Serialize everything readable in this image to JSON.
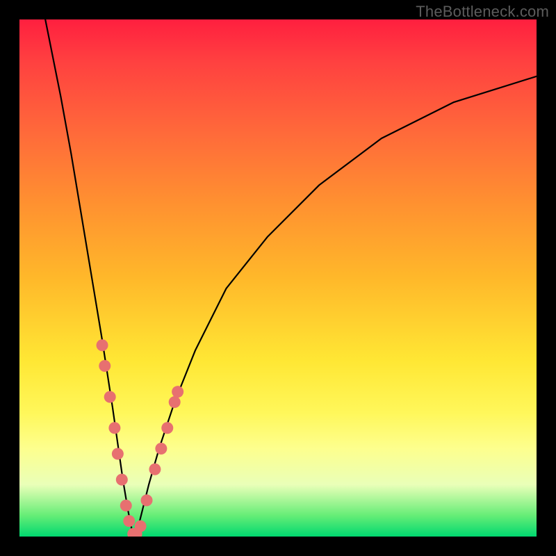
{
  "watermark": "TheBottleneck.com",
  "colors": {
    "curve_stroke": "#000000",
    "marker_fill": "#e77070",
    "marker_stroke": "#c85858",
    "gradient_top": "#ff1f3f",
    "gradient_bottom": "#00d870",
    "frame_bg": "#000000"
  },
  "chart_data": {
    "type": "line",
    "title": "",
    "xlabel": "",
    "ylabel": "",
    "xlim": [
      0,
      100
    ],
    "ylim": [
      0,
      100
    ],
    "grid": false,
    "legend": false,
    "note": "V-shaped bottleneck curve; y=0 at minimum (~x=22), rises steeply both sides. Markers cluster near the trough on both branches where y is low (green band).",
    "series": [
      {
        "name": "bottleneck-curve",
        "x": [
          5,
          8,
          10,
          12,
          14,
          16,
          18,
          19,
          20,
          21,
          22,
          23,
          24,
          25,
          27,
          30,
          34,
          40,
          48,
          58,
          70,
          84,
          100
        ],
        "y": [
          100,
          85,
          74,
          62,
          50,
          38,
          25,
          18,
          11,
          5,
          0,
          2,
          6,
          10,
          17,
          26,
          36,
          48,
          58,
          68,
          77,
          84,
          89
        ]
      }
    ],
    "markers": [
      {
        "x": 16.0,
        "y": 37
      },
      {
        "x": 16.5,
        "y": 33
      },
      {
        "x": 17.5,
        "y": 27
      },
      {
        "x": 18.4,
        "y": 21
      },
      {
        "x": 19.0,
        "y": 16
      },
      {
        "x": 19.8,
        "y": 11
      },
      {
        "x": 20.6,
        "y": 6
      },
      {
        "x": 21.2,
        "y": 3
      },
      {
        "x": 22.0,
        "y": 0.5
      },
      {
        "x": 22.6,
        "y": 0.5
      },
      {
        "x": 23.4,
        "y": 2
      },
      {
        "x": 24.6,
        "y": 7
      },
      {
        "x": 26.2,
        "y": 13
      },
      {
        "x": 27.4,
        "y": 17
      },
      {
        "x": 28.6,
        "y": 21
      },
      {
        "x": 30.0,
        "y": 26
      },
      {
        "x": 30.6,
        "y": 28
      }
    ]
  }
}
